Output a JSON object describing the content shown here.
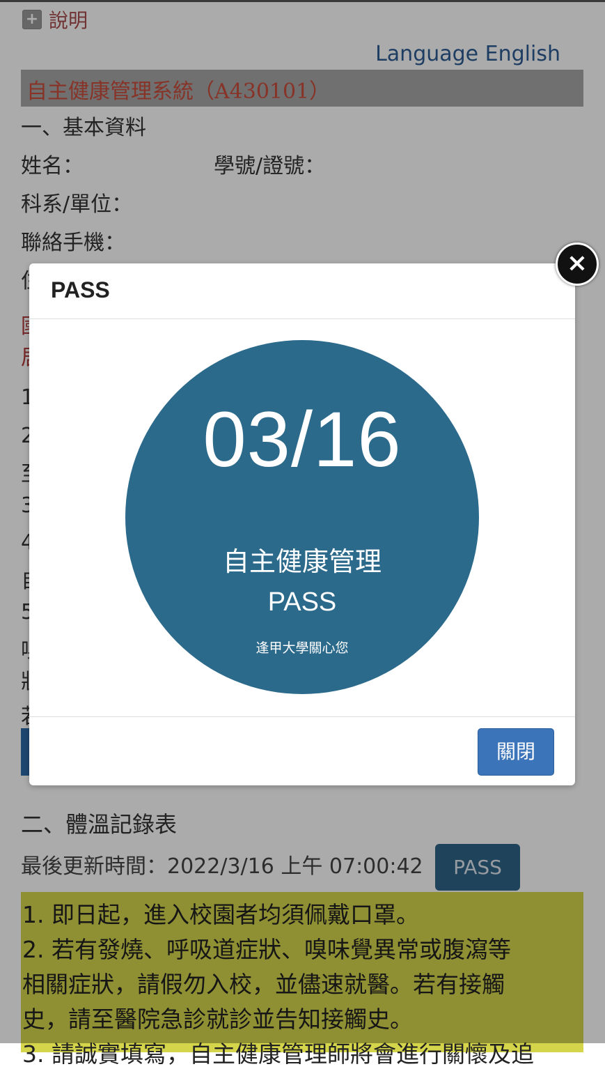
{
  "help": {
    "label": "說明"
  },
  "language": {
    "label": "Language English"
  },
  "header": {
    "title": "自主健康管理系統（A430101）"
  },
  "basic_info": {
    "section_title": "一、基本資料",
    "name_label": "姓名：",
    "id_label": "學號/證號：",
    "dept_label": "科系/單位：",
    "phone_label": "聯絡手機："
  },
  "partially_hidden_lines": {
    "l1": "住",
    "l2": "國",
    "l3": "居",
    "l4": "1",
    "l5": "2",
    "l6": "至",
    "l7": "3",
    "l8": "4",
    "l9": "自",
    "l10": "5",
    "l11": "嗅",
    "l12": "狀",
    "l13": "若"
  },
  "modal": {
    "title": "PASS",
    "badge_date": "03/16",
    "badge_subtitle": "自主健康管理",
    "badge_status": "PASS",
    "badge_caption": "逢甲大學關心您",
    "close_button": "關閉",
    "x_button": "×"
  },
  "temperature": {
    "section_title": "二、體溫記錄表",
    "last_update": "最後更新時間：2022/3/16 上午 07:00:42",
    "status_button": "PASS"
  },
  "notice": {
    "line1": "1. 即日起，進入校園者均須佩戴口罩。",
    "line2": "2. 若有發燒、呼吸道症狀、嗅味覺異常或腹瀉等",
    "line3": "相關症狀，請假勿入校，並儘速就醫。若有接觸",
    "line4": "史，請至醫院急診就診並告知接觸史。",
    "line5": "3. 請誠實填寫，自主健康管理師將會進行關懷及追"
  },
  "colors": {
    "badge_blue": "#2c6a8c",
    "glow_yellow": "#f6e54a",
    "button_blue": "#3b74b8",
    "notice_yellow": "#d5d54c",
    "title_red": "#c94d3c"
  }
}
